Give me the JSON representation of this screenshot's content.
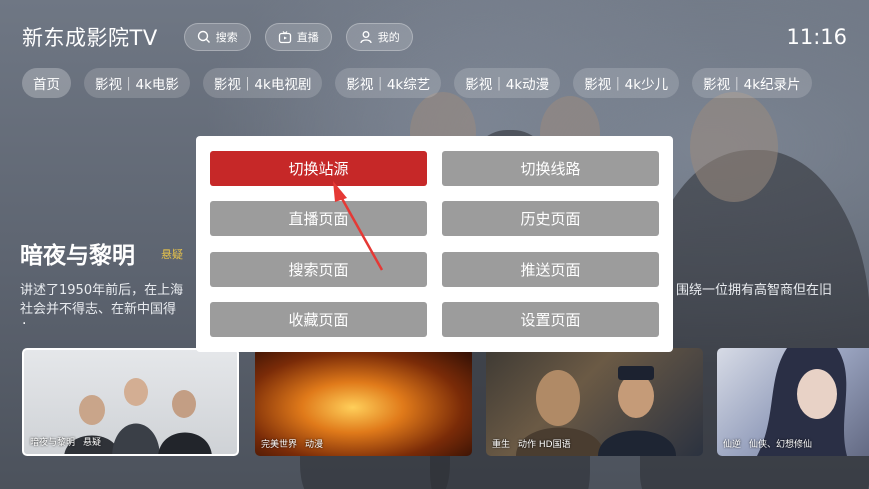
{
  "app": {
    "title": "新东成影院TV",
    "clock": "11:16"
  },
  "top_actions": [
    {
      "label": "搜索",
      "icon": "search-icon"
    },
    {
      "label": "直播",
      "icon": "live-tv-icon"
    },
    {
      "label": "我的",
      "icon": "user-icon"
    }
  ],
  "tabs": [
    {
      "label": "首页",
      "active": true
    },
    {
      "label": "影视｜4k电影"
    },
    {
      "label": "影视｜4k电视剧"
    },
    {
      "label": "影视｜4k综艺"
    },
    {
      "label": "影视｜4k动漫"
    },
    {
      "label": "影视｜4k少儿"
    },
    {
      "label": "影视｜4k纪录片"
    }
  ],
  "featured": {
    "title": "暗夜与黎明",
    "tag": "悬疑",
    "description_line1": "讲述了1950年前后，在上海",
    "description_line2": "社会并不得志、在新中国得",
    "description_right": "围绕一位拥有高智商但在旧",
    "description_dot": "·"
  },
  "modal": {
    "buttons": [
      {
        "label": "切换站源",
        "primary": true
      },
      {
        "label": "切换线路"
      },
      {
        "label": "直播页面"
      },
      {
        "label": "历史页面"
      },
      {
        "label": "搜索页面"
      },
      {
        "label": "推送页面"
      },
      {
        "label": "收藏页面"
      },
      {
        "label": "设置页面"
      }
    ]
  },
  "cards": [
    {
      "title": "暗夜与黎明",
      "genre": "悬疑"
    },
    {
      "title": "完美世界",
      "genre": "动漫"
    },
    {
      "title": "重生",
      "genre": "动作 HD国语"
    },
    {
      "title": "仙逆",
      "genre": "仙侠、幻想修仙"
    }
  ],
  "colors": {
    "accent": "#c62828",
    "button_grey": "#9c9c9c",
    "tag_yellow": "#e6c24a"
  }
}
